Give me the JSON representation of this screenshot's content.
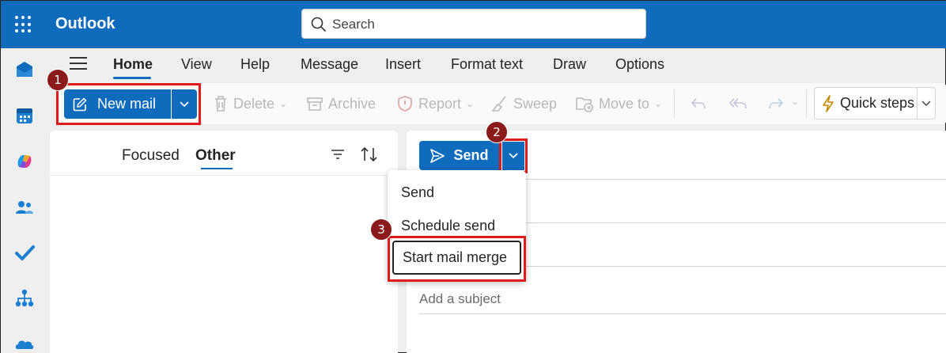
{
  "app": {
    "title": "Outlook"
  },
  "search": {
    "placeholder": "Search"
  },
  "tabs": [
    {
      "label": "Home"
    },
    {
      "label": "View"
    },
    {
      "label": "Help"
    },
    {
      "label": "Message"
    },
    {
      "label": "Insert"
    },
    {
      "label": "Format text"
    },
    {
      "label": "Draw"
    },
    {
      "label": "Options"
    }
  ],
  "ribbon": {
    "new_mail": "New mail",
    "delete": "Delete",
    "archive": "Archive",
    "report": "Report",
    "sweep": "Sweep",
    "move_to": "Move to",
    "quick_steps": "Quick steps"
  },
  "list": {
    "tab_focused": "Focused",
    "tab_other": "Other"
  },
  "compose": {
    "send": "Send",
    "subject_placeholder": "Add a subject"
  },
  "send_menu": {
    "items": [
      {
        "label": "Send"
      },
      {
        "label": "Schedule send"
      },
      {
        "label": "Start mail merge"
      }
    ]
  },
  "callouts": [
    "1",
    "2",
    "3"
  ],
  "colors": {
    "accent": "#0f6cbd",
    "highlight": "#e01b1b",
    "badge": "#8b1a1a"
  },
  "icons": [
    "app-launcher-icon",
    "search-icon",
    "mail-icon",
    "calendar-icon",
    "copilot-icon",
    "people-icon",
    "todo-icon",
    "org-icon",
    "onedrive-icon",
    "compose-icon",
    "trash-icon",
    "archive-icon",
    "report-icon",
    "sweep-icon",
    "move-icon",
    "undo-icon",
    "reply-all-icon",
    "forward-icon",
    "lightning-icon",
    "filter-icon",
    "sort-icon",
    "send-icon"
  ]
}
